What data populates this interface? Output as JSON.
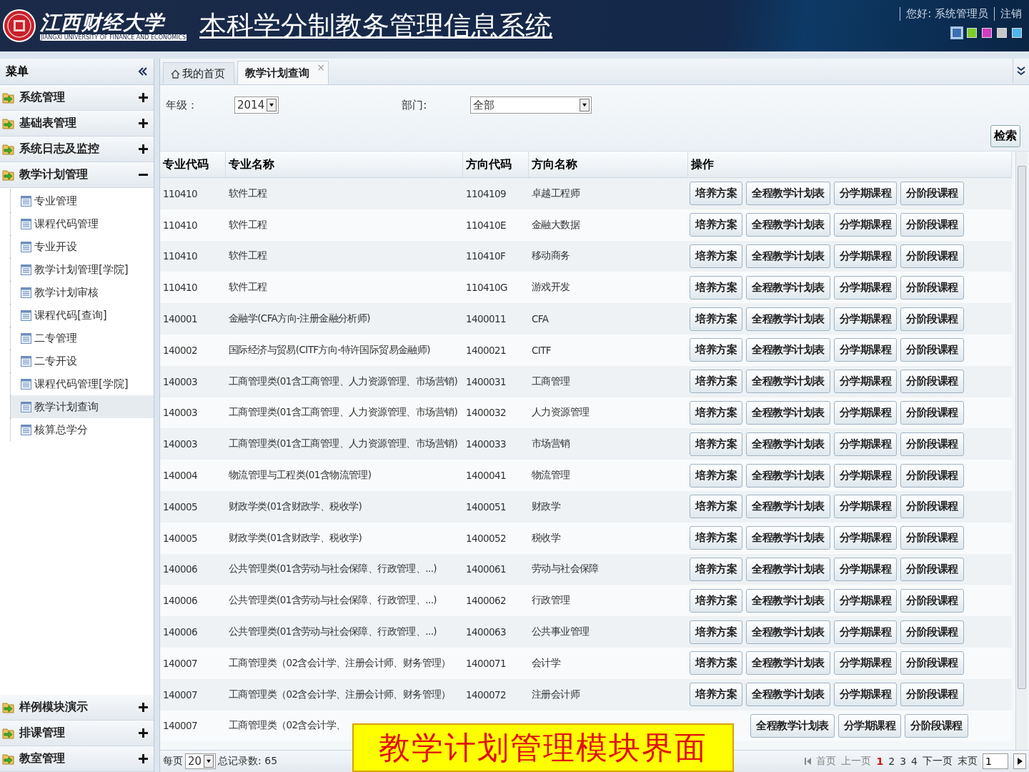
{
  "header": {
    "university": "江西财经大学",
    "university_en": "JIANGXI UNIVERSITY OF FINANCE AND ECONOMICS",
    "title": "本科学分制教务管理信息系统",
    "greeting": "您好: 系统管理员",
    "logout": "注销",
    "skins": [
      {
        "color": "#3a6fb8",
        "selected": true
      },
      {
        "color": "#7ccc2a",
        "selected": false
      },
      {
        "color": "#d43cc4",
        "selected": false
      },
      {
        "color": "#c8c8c8",
        "selected": false
      },
      {
        "color": "#4cb8ee",
        "selected": false
      }
    ]
  },
  "sidebar": {
    "title": "菜单",
    "groups": [
      {
        "label": "系统管理",
        "expanded": false
      },
      {
        "label": "基础表管理",
        "expanded": false
      },
      {
        "label": "系统日志及监控",
        "expanded": false
      },
      {
        "label": "教学计划管理",
        "expanded": true,
        "children": [
          {
            "label": "专业管理",
            "selected": false
          },
          {
            "label": "课程代码管理",
            "selected": false
          },
          {
            "label": "专业开设",
            "selected": false
          },
          {
            "label": "教学计划管理[学院]",
            "selected": false
          },
          {
            "label": "教学计划审核",
            "selected": false
          },
          {
            "label": "课程代码[查询]",
            "selected": false
          },
          {
            "label": "二专管理",
            "selected": false
          },
          {
            "label": "二专开设",
            "selected": false
          },
          {
            "label": "课程代码管理[学院]",
            "selected": false
          },
          {
            "label": "教学计划查询",
            "selected": true
          },
          {
            "label": "核算总学分",
            "selected": false
          }
        ]
      }
    ],
    "bottom_groups": [
      {
        "label": "样例模块演示",
        "expanded": false
      },
      {
        "label": "排课管理",
        "expanded": false
      },
      {
        "label": "教室管理",
        "expanded": false
      }
    ]
  },
  "tabs": [
    {
      "label": "我的首页",
      "selected": false,
      "kind": "home"
    },
    {
      "label": "教学计划查询",
      "selected": true,
      "kind": "closable",
      "close": "×"
    }
  ],
  "filters": {
    "grade_label": "年级：",
    "grade": "2014",
    "dept_label": "部门:",
    "dept": "全部",
    "search_button": "检索"
  },
  "table": {
    "columns": [
      "专业代码",
      "专业名称",
      "方向代码",
      "方向名称",
      "操作"
    ],
    "rows": [
      {
        "cells": [
          "110410",
          "软件工程",
          "1104109",
          "卓越工程师"
        ],
        "actions": [
          "培养方案",
          "全程教学计划表",
          "分学期课程",
          "分阶段课程"
        ]
      },
      {
        "cells": [
          "110410",
          "软件工程",
          "110410E",
          "金融大数据"
        ],
        "actions": [
          "培养方案",
          "全程教学计划表",
          "分学期课程",
          "分阶段课程"
        ]
      },
      {
        "cells": [
          "110410",
          "软件工程",
          "110410F",
          "移动商务"
        ],
        "actions": [
          "培养方案",
          "全程教学计划表",
          "分学期课程",
          "分阶段课程"
        ]
      },
      {
        "cells": [
          "110410",
          "软件工程",
          "110410G",
          "游戏开发"
        ],
        "actions": [
          "培养方案",
          "全程教学计划表",
          "分学期课程",
          "分阶段课程"
        ]
      },
      {
        "cells": [
          "140001",
          "金融学(CFA方向-注册金融分析师)",
          "1400011",
          "CFA"
        ],
        "actions": [
          "培养方案",
          "全程教学计划表",
          "分学期课程",
          "分阶段课程"
        ]
      },
      {
        "cells": [
          "140002",
          "国际经济与贸易(CITF方向-特许国际贸易金融师)",
          "1400021",
          "CITF"
        ],
        "actions": [
          "培养方案",
          "全程教学计划表",
          "分学期课程",
          "分阶段课程"
        ]
      },
      {
        "cells": [
          "140003",
          "工商管理类(01含工商管理、人力资源管理、市场营销)",
          "1400031",
          "工商管理"
        ],
        "actions": [
          "培养方案",
          "全程教学计划表",
          "分学期课程",
          "分阶段课程"
        ]
      },
      {
        "cells": [
          "140003",
          "工商管理类(01含工商管理、人力资源管理、市场营销)",
          "1400032",
          "人力资源管理"
        ],
        "actions": [
          "培养方案",
          "全程教学计划表",
          "分学期课程",
          "分阶段课程"
        ]
      },
      {
        "cells": [
          "140003",
          "工商管理类(01含工商管理、人力资源管理、市场营销)",
          "1400033",
          "市场营销"
        ],
        "actions": [
          "培养方案",
          "全程教学计划表",
          "分学期课程",
          "分阶段课程"
        ]
      },
      {
        "cells": [
          "140004",
          "物流管理与工程类(01含物流管理)",
          "1400041",
          "物流管理"
        ],
        "actions": [
          "培养方案",
          "全程教学计划表",
          "分学期课程",
          "分阶段课程"
        ]
      },
      {
        "cells": [
          "140005",
          "财政学类(01含财政学、税收学)",
          "1400051",
          "财政学"
        ],
        "actions": [
          "培养方案",
          "全程教学计划表",
          "分学期课程",
          "分阶段课程"
        ]
      },
      {
        "cells": [
          "140005",
          "财政学类(01含财政学、税收学)",
          "1400052",
          "税收学"
        ],
        "actions": [
          "培养方案",
          "全程教学计划表",
          "分学期课程",
          "分阶段课程"
        ]
      },
      {
        "cells": [
          "140006",
          "公共管理类(01含劳动与社会保障、行政管理、...)",
          "1400061",
          "劳动与社会保障"
        ],
        "actions": [
          "培养方案",
          "全程教学计划表",
          "分学期课程",
          "分阶段课程"
        ]
      },
      {
        "cells": [
          "140006",
          "公共管理类(01含劳动与社会保障、行政管理、...)",
          "1400062",
          "行政管理"
        ],
        "actions": [
          "培养方案",
          "全程教学计划表",
          "分学期课程",
          "分阶段课程"
        ]
      },
      {
        "cells": [
          "140006",
          "公共管理类(01含劳动与社会保障、行政管理、...)",
          "1400063",
          "公共事业管理"
        ],
        "actions": [
          "培养方案",
          "全程教学计划表",
          "分学期课程",
          "分阶段课程"
        ]
      },
      {
        "cells": [
          "140007",
          "工商管理类（02含会计学、注册会计师、财务管理）",
          "1400071",
          "会计学"
        ],
        "actions": [
          "培养方案",
          "全程教学计划表",
          "分学期课程",
          "分阶段课程"
        ]
      },
      {
        "cells": [
          "140007",
          "工商管理类（02含会计学、注册会计师、财务管理）",
          "1400072",
          "注册会计师"
        ],
        "actions": [
          "培养方案",
          "全程教学计划表",
          "分学期课程",
          "分阶段课程"
        ]
      },
      {
        "cells": [
          "140007",
          "工商管理类（02含会计学、"
        ],
        "actions": [
          "全程教学计划表",
          "分学期课程",
          "分阶段课程"
        ]
      }
    ]
  },
  "pager": {
    "per_page_label": "每页",
    "per_page": "20",
    "total": "总记录数: 65",
    "first": "首页",
    "prev": "上一页",
    "pages": [
      {
        "label": "1",
        "selected": true
      },
      {
        "label": "2",
        "selected": false
      },
      {
        "label": "3",
        "selected": false
      },
      {
        "label": "4",
        "selected": false
      }
    ],
    "next": "下一页",
    "last": "末页",
    "page_input": "1"
  },
  "caption": "教学计划管理模块界面"
}
